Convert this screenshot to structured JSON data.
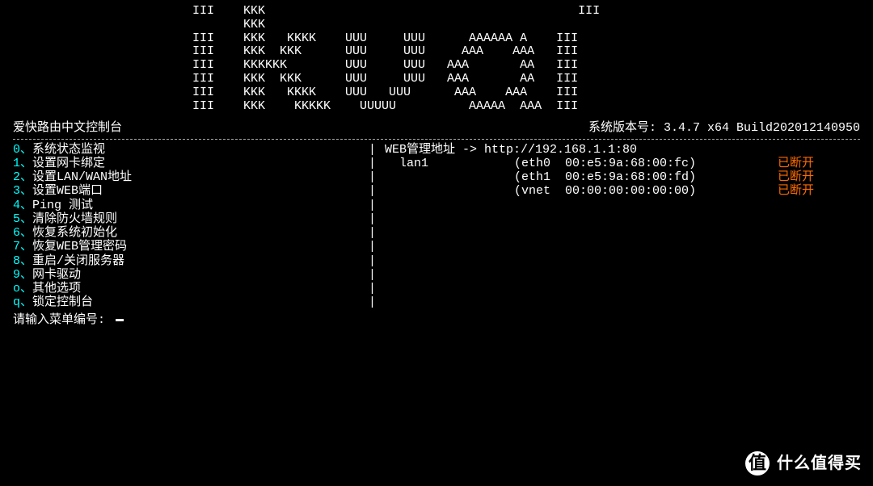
{
  "ascii_logo": "III    KKK                                           III\n       KKK\nIII    KKK   KKKK    UUU     UUU      AAAAAA A    III\nIII    KKK  KKK      UUU     UUU     AAA    AAA   III\nIII    KKKKKK        UUU     UUU   AAA       AA   III\nIII    KKK  KKK      UUU     UUU   AAA       AA   III\nIII    KKK   KKKK    UUU   UUU      AAA    AAA    III\nIII    KKK    KKKKK    UUUUU          AAAAA  AAA  III",
  "title_left": "爱快路由中文控制台",
  "title_right": "系统版本号: 3.4.7 x64 Build202012140950",
  "menu": [
    {
      "key": "0",
      "label": "系统状态监视"
    },
    {
      "key": "1",
      "label": "设置网卡绑定"
    },
    {
      "key": "2",
      "label": "设置LAN/WAN地址"
    },
    {
      "key": "3",
      "label": "设置WEB端口"
    },
    {
      "key": "4",
      "label": "Ping 测试"
    },
    {
      "key": "5",
      "label": "清除防火墙规则"
    },
    {
      "key": "6",
      "label": "恢复系统初始化"
    },
    {
      "key": "7",
      "label": "恢复WEB管理密码"
    },
    {
      "key": "8",
      "label": "重启/关闭服务器"
    },
    {
      "key": "9",
      "label": "网卡驱动"
    },
    {
      "key": "o",
      "label": "其他选项"
    },
    {
      "key": "q",
      "label": "锁定控制台"
    }
  ],
  "menu_sep": "、",
  "info_header_label": "WEB管理地址 -> ",
  "info_header_url": "http://192.168.1.1:80",
  "interfaces": [
    {
      "lan": "lan1",
      "dev": "eth0",
      "mac": "00:e5:9a:68:00:fc",
      "status": "已断开"
    },
    {
      "lan": "",
      "dev": "eth1",
      "mac": "00:e5:9a:68:00:fd",
      "status": "已断开"
    },
    {
      "lan": "",
      "dev": "vnet",
      "mac": "00:00:00:00:00:00",
      "status": "已断开"
    }
  ],
  "prompt": "请输入菜单编号:",
  "watermark_char": "值",
  "watermark_text": "什么值得买"
}
